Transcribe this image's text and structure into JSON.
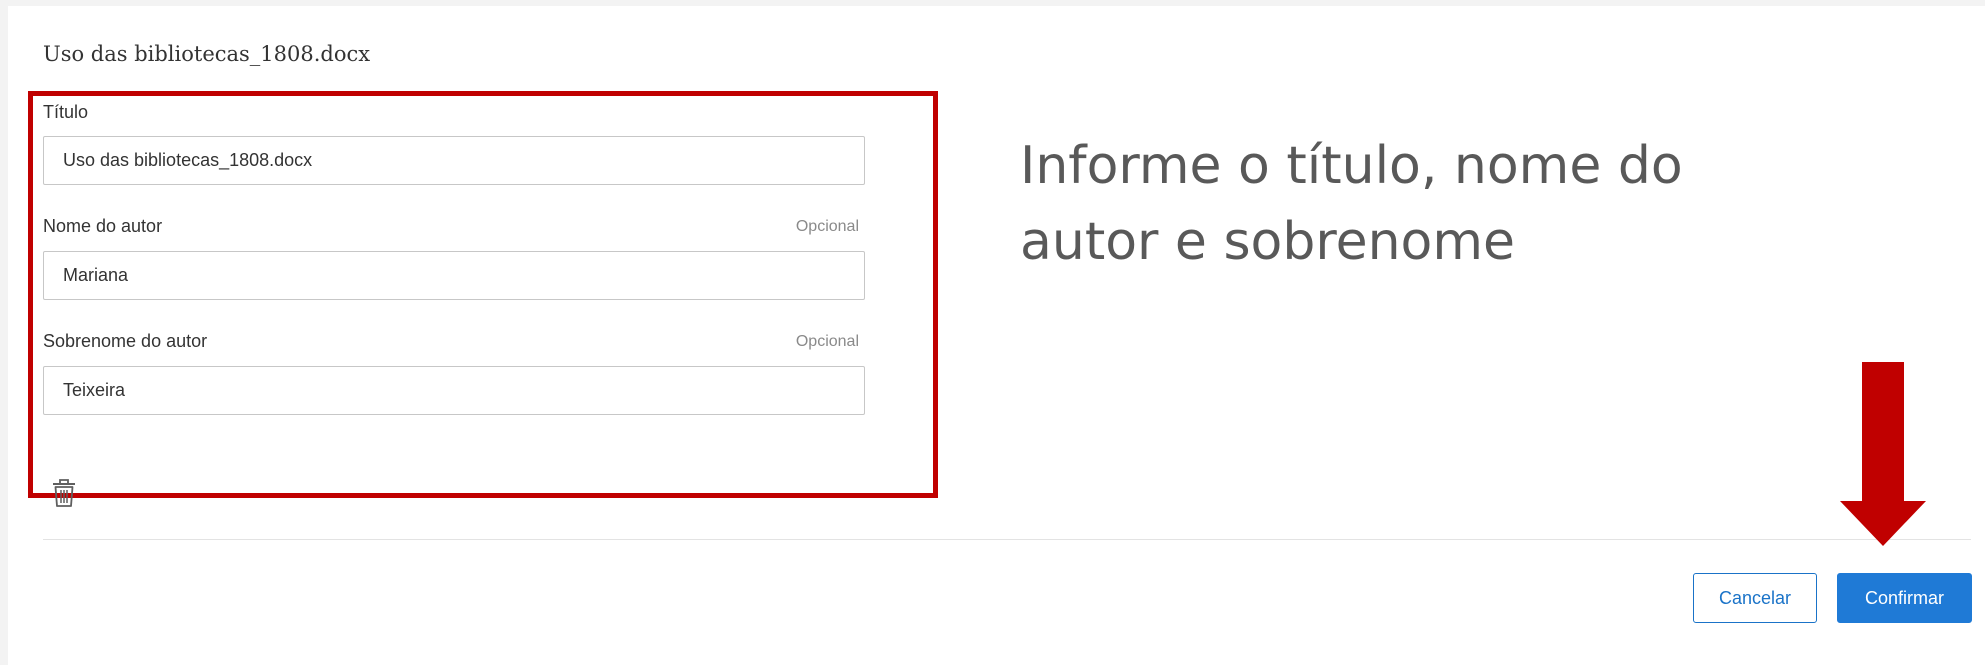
{
  "dialog": {
    "document_name": "Uso das bibliotecas_1808.docx",
    "fields": {
      "title": {
        "label": "Título",
        "value": "Uso das bibliotecas_1808.docx"
      },
      "author_first_name": {
        "label": "Nome do autor",
        "optional_tag": "Opcional",
        "value": "Mariana"
      },
      "author_last_name": {
        "label": "Sobrenome do autor",
        "optional_tag": "Opcional",
        "value": "Teixeira"
      }
    },
    "delete_icon": "trash-icon",
    "buttons": {
      "cancel": "Cancelar",
      "confirm": "Confirmar"
    }
  },
  "annotation": {
    "callout_text": "Informe o título, nome do autor e sobrenome",
    "highlight_color": "#c00000",
    "arrow_color": "#c00000",
    "arrow_icon": "arrow-down-icon"
  },
  "colors": {
    "primary": "#1f7ad6",
    "text": "#333333",
    "muted": "#8a8a8a"
  }
}
